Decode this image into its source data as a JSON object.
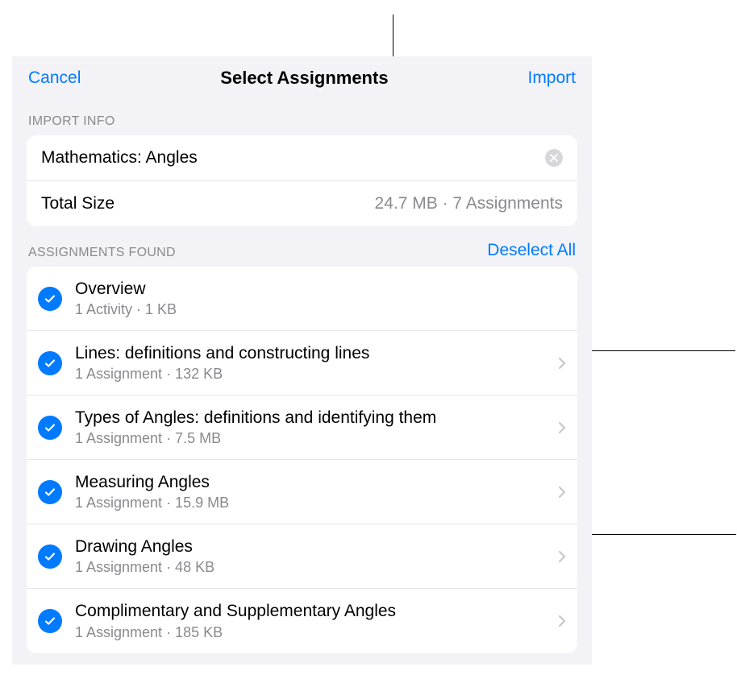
{
  "nav": {
    "cancel": "Cancel",
    "title": "Select Assignments",
    "import": "Import"
  },
  "import_info": {
    "section_label": "IMPORT INFO",
    "title": "Mathematics: Angles",
    "total_size_label": "Total Size",
    "total_size_value": "24.7 MB · 7 Assignments"
  },
  "assignments_found": {
    "section_label": "ASSIGNMENTS FOUND",
    "deselect_all": "Deselect All",
    "items": [
      {
        "title": "Overview",
        "subtitle": "1 Activity · 1 KB",
        "has_chevron": false
      },
      {
        "title": "Lines: definitions and constructing lines",
        "subtitle": "1 Assignment · 132 KB",
        "has_chevron": true
      },
      {
        "title": "Types of Angles: definitions and identifying them",
        "subtitle": "1 Assignment · 7.5 MB",
        "has_chevron": true
      },
      {
        "title": "Measuring Angles",
        "subtitle": "1 Assignment · 15.9 MB",
        "has_chevron": true
      },
      {
        "title": "Drawing Angles",
        "subtitle": "1 Assignment · 48 KB",
        "has_chevron": true
      },
      {
        "title": "Complimentary and Supplementary Angles",
        "subtitle": "1 Assignment · 185 KB",
        "has_chevron": true
      }
    ]
  }
}
